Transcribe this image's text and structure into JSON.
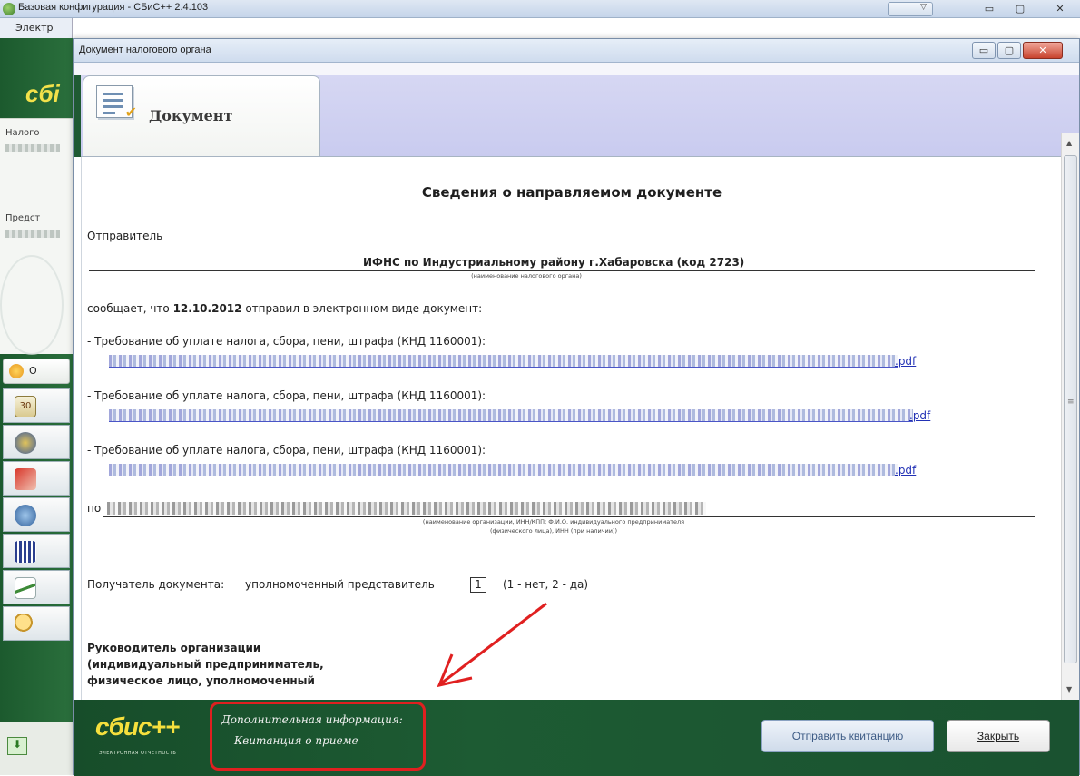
{
  "app": {
    "title": "Базовая конфигурация - СБиС++ 2.4.103",
    "menu_partial": "Электр",
    "sidebar_logo_partial": "сбі",
    "panel_label_1": "Налого",
    "panel_label_2": "Предст",
    "button_partial": "О"
  },
  "dialog": {
    "title": "Документ налогового органа",
    "tab_label": "Документ",
    "min_glyph": "▭",
    "max_glyph": "▢",
    "close_glyph": "✕"
  },
  "document": {
    "heading": "Сведения о направляемом документе",
    "sender_label": "Отправитель",
    "tax_office": "ИФНС по Индустриальному району г.Хабаровска (код 2723)",
    "tax_office_caption": "(наименование налогового органа)",
    "message_prefix": "сообщает, что ",
    "message_date": "12.10.2012",
    "message_suffix": " отправил в электронном виде документ:",
    "items": [
      {
        "label": "- Требование об уплате налога, сбора, пени, штрафа (КНД 1160001):",
        "ext": ".pdf"
      },
      {
        "label": "- Требование об уплате налога, сбора, пени, штрафа (КНД 1160001):",
        "ext": ".pdf"
      },
      {
        "label": "- Требование об уплате налога, сбора, пени, штрафа (КНД 1160001):",
        "ext": ".pdf"
      }
    ],
    "org_prefix": "по",
    "org_caption_line1": "(наименование организации, ИНН/КПП; Ф.И.О. индивидуального предпринимателя",
    "org_caption_line2": "(физического лица), ИНН (при наличии))",
    "recipient_label": "Получатель документа:",
    "recipient_value": "уполномоченный представитель",
    "recipient_code": "1",
    "recipient_hint": "(1 - нет, 2 - да)",
    "head_line1": "Руководитель организации",
    "head_line2": "(индивидуальный предприниматель,",
    "head_line3": "физическое лицо, уполномоченный"
  },
  "footer": {
    "logo": "сбис++",
    "logo_sub": "ЭЛЕКТРОННАЯ ОТЧЕТНОСТЬ",
    "additional_info_label": "Дополнительная информация:",
    "additional_info_value": "Квитанция о приеме",
    "send_receipt_button": "Отправить квитанцию",
    "close_button": "Закрыть"
  },
  "colors": {
    "footer_green": "#1d5b33",
    "logo_yellow": "#f5df3d",
    "highlight_red": "#e02020",
    "link_blue": "#2231b5"
  }
}
